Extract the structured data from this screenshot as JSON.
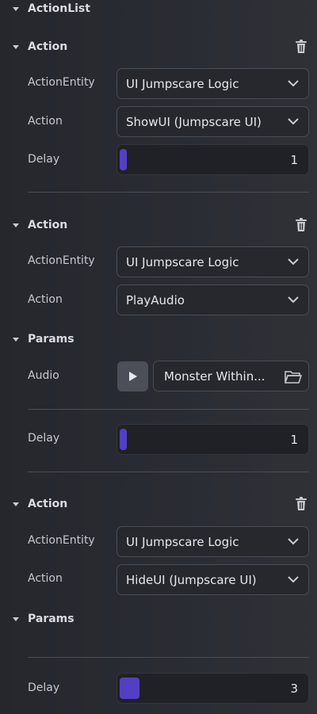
{
  "header": {
    "title": "ActionList"
  },
  "actions": [
    {
      "title": "Action",
      "entity_label": "ActionEntity",
      "entity_value": "UI Jumpscare Logic",
      "action_label": "Action",
      "action_value": "ShowUI (Jumpscare UI)",
      "delay_label": "Delay",
      "delay_value": "1"
    },
    {
      "title": "Action",
      "entity_label": "ActionEntity",
      "entity_value": "UI Jumpscare Logic",
      "action_label": "Action",
      "action_value": "PlayAudio",
      "params_title": "Params",
      "audio_label": "Audio",
      "audio_value": "Monster Within...",
      "delay_label": "Delay",
      "delay_value": "1"
    },
    {
      "title": "Action",
      "entity_label": "ActionEntity",
      "entity_value": "UI Jumpscare Logic",
      "action_label": "Action",
      "action_value": "HideUI (Jumpscare UI)",
      "params_title": "Params",
      "delay_label": "Delay",
      "delay_value": "3"
    }
  ],
  "colors": {
    "accent": "#5140c4",
    "background": "#2a2c33",
    "field_border": "#4a4d55"
  },
  "icons": [
    "caret-down-icon",
    "trash-icon",
    "chevron-down-icon",
    "play-icon",
    "folder-icon"
  ]
}
